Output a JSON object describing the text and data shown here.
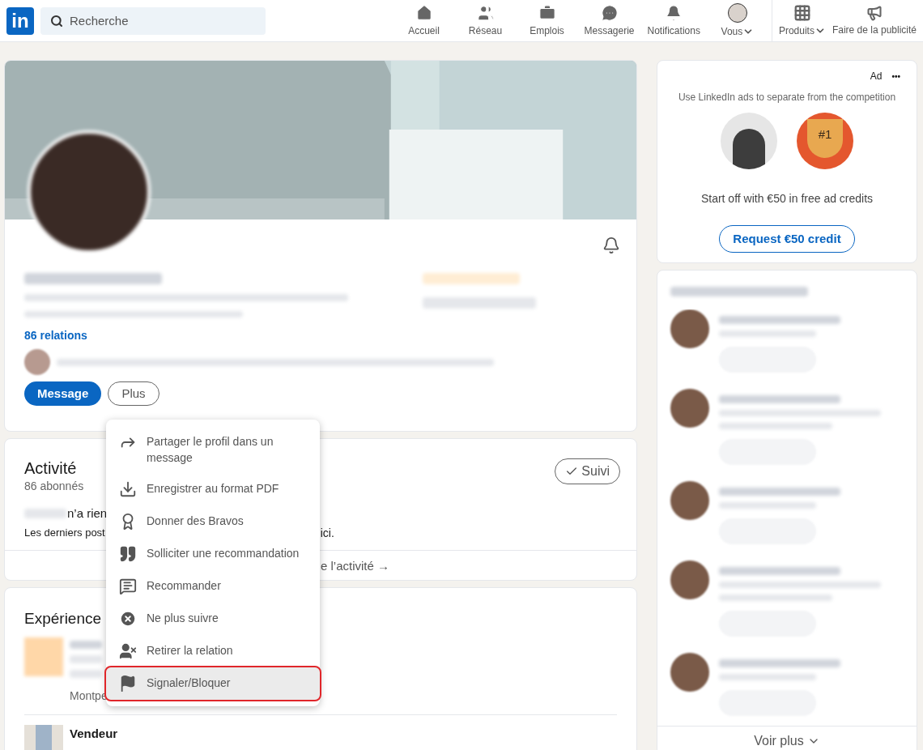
{
  "header": {
    "logo": "in",
    "search": {
      "placeholder": "Recherche"
    },
    "nav": [
      {
        "label": "Accueil",
        "kind": "home",
        "selected": false
      },
      {
        "label": "Réseau",
        "kind": "network",
        "selected": false
      },
      {
        "label": "Emplois",
        "kind": "jobs",
        "selected": false
      },
      {
        "label": "Messagerie",
        "kind": "messaging",
        "selected": false
      },
      {
        "label": "Notifications",
        "kind": "notifications",
        "selected": false
      },
      {
        "label": "Vous",
        "kind": "me",
        "selected": false
      }
    ],
    "nav_right": [
      {
        "label": "Produits",
        "kind": "products"
      },
      {
        "label": "Faire de la publicité",
        "kind": "ads"
      }
    ]
  },
  "profile": {
    "relations": "86 relations",
    "buttons": {
      "primary": "Message",
      "secondary": "Plus"
    }
  },
  "menu": [
    {
      "label": "Partager le profil dans un message",
      "kind": "share",
      "selected": false
    },
    {
      "label": "Enregistrer au format PDF",
      "kind": "download",
      "selected": false
    },
    {
      "label": "Donner des Bravos",
      "kind": "award",
      "selected": false
    },
    {
      "label": "Solliciter une recommandation",
      "kind": "quote",
      "selected": false
    },
    {
      "label": "Recommander",
      "kind": "comment",
      "selected": false
    },
    {
      "label": "Ne plus suivre",
      "kind": "unfollow",
      "selected": false
    },
    {
      "label": "Retirer la relation",
      "kind": "remove",
      "selected": false
    },
    {
      "label": "Signaler/Bloquer",
      "kind": "flag",
      "selected": true
    }
  ],
  "activity": {
    "title": "Activité",
    "followers": "86 abonnés",
    "follow_button": "Suivi",
    "line_1": "n’a rien",
    "line_2_start": "Les derniers post",
    "line_2_end": "ici.",
    "see_all": "e l’activité →"
  },
  "experience": {
    "title": "Expérience",
    "location_start": "Montpe",
    "job_title": "Vendeur"
  },
  "ad": {
    "label": "Ad",
    "more": "•••",
    "tagline": "Use LinkedIn ads to separate from the competition",
    "badge": "#1",
    "offer": "Start off with €50 in free ad credits",
    "button": "Request €50 credit"
  },
  "suggestions": {
    "more": "Voir plus"
  }
}
